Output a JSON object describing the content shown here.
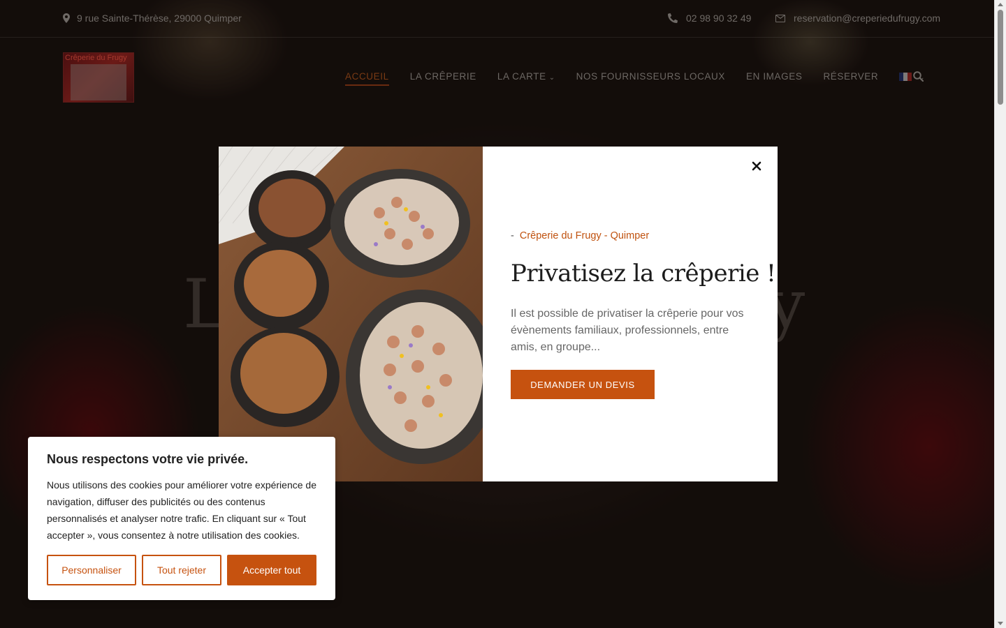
{
  "topbar": {
    "address": "9 rue Sainte-Thérèse, 29000 Quimper",
    "phone": "02 98 90 32 49",
    "email": "reservation@creperiedufrugy.com"
  },
  "header": {
    "logo_text": "Crêperie du Frugy",
    "nav": [
      {
        "label": "ACCUEIL",
        "active": true
      },
      {
        "label": "LA CRÊPERIE"
      },
      {
        "label": "LA CARTE",
        "has_dropdown": true
      },
      {
        "label": "NOS FOURNISSEURS LOCAUX"
      },
      {
        "label": "EN IMAGES"
      },
      {
        "label": "RÉSERVER"
      }
    ],
    "language": "fr",
    "icons": {
      "search": "search-icon",
      "language": "france-flag-icon"
    }
  },
  "hero": {
    "title_fragment_left": "L",
    "title_fragment_right": "y"
  },
  "modal": {
    "subtitle_dash": "-",
    "subtitle": "Crêperie du Frugy - Quimper",
    "title": "Privatisez la crêperie !",
    "text": "Il est possible de privatiser la crêperie pour vos évènements familiaux, professionnels, entre amis, en groupe...",
    "cta_label": "DEMANDER UN DEVIS",
    "close_icon": "close-icon"
  },
  "cookie": {
    "title": "Nous respectons votre vie privée.",
    "text": "Nous utilisons des cookies pour améliorer votre expérience de navigation, diffuser des publicités ou des contenus personnalisés et analyser notre trafic. En cliquant sur « Tout accepter », vous consentez à notre utilisation des cookies.",
    "btn_customize": "Personnaliser",
    "btn_reject": "Tout rejeter",
    "btn_accept": "Accepter tout"
  },
  "colors": {
    "accent": "#c6520f",
    "text_dark": "#1c1c1c",
    "text_muted": "#666666"
  }
}
